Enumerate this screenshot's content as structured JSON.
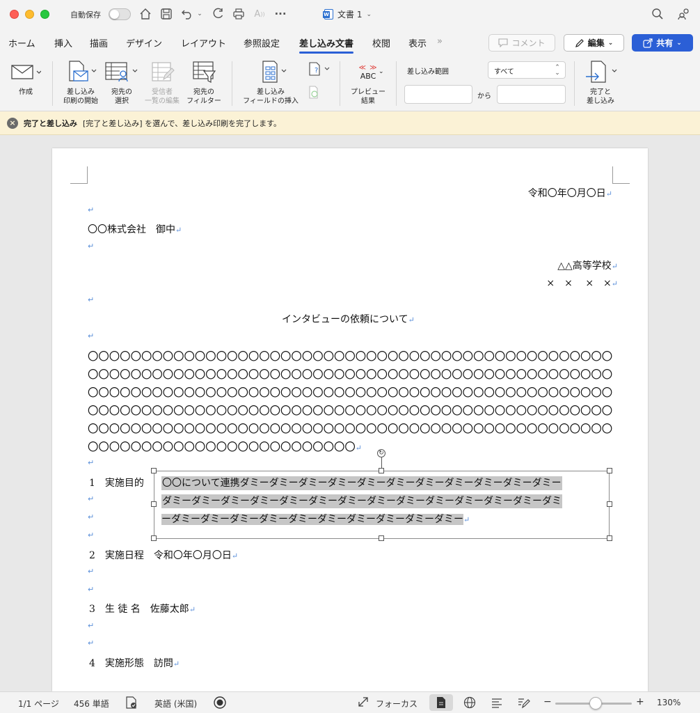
{
  "titlebar": {
    "autosave_label": "自動保存",
    "doc_title": "文書 1",
    "icons": [
      "home-icon",
      "save-icon",
      "undo-icon",
      "redo-icon",
      "print-icon",
      "read-aloud-icon",
      "more-icon",
      "search-icon",
      "share-people-icon"
    ]
  },
  "tabs": [
    {
      "label": "ホーム"
    },
    {
      "label": "挿入"
    },
    {
      "label": "描画"
    },
    {
      "label": "デザイン"
    },
    {
      "label": "レイアウト"
    },
    {
      "label": "参照設定"
    },
    {
      "label": "差し込み文書",
      "active": true
    },
    {
      "label": "校閲"
    },
    {
      "label": "表示"
    }
  ],
  "tab_overflow": "»",
  "buttons": {
    "comment": "コメント",
    "edit": "編集",
    "share": "共有"
  },
  "ribbon": {
    "create": "作成",
    "start_merge": "差し込み\n印刷の開始",
    "select_recipients": "宛先の\n選択",
    "edit_recipients": "受信者\n一覧の編集",
    "filter_recipients": "宛先の\nフィルター",
    "insert_field": "差し込み\nフィールドの挿入",
    "preview_abc": "ABC",
    "preview": "プレビュー\n結果",
    "range_label": "差し込み範囲",
    "range_value": "すべて",
    "range_from_label": "から",
    "finish_merge": "完了と\n差し込み"
  },
  "message_bar": {
    "title": "完了と差し込み",
    "text": "[完了と差し込み] を選んで、差し込み印刷を完了します。"
  },
  "document": {
    "date": "令和〇年〇月〇日",
    "recipient": "〇〇株式会社　御中",
    "sender_school": "△△高等学校",
    "sender_name": "×　×　 ×　×",
    "title": "インタビューの依頼について",
    "circle_lines": [
      "〇〇〇〇〇〇〇〇〇〇〇〇〇〇〇〇〇〇〇〇〇〇〇〇〇〇〇〇〇〇〇〇〇〇〇〇〇〇〇〇〇〇〇〇〇〇〇〇〇",
      "〇〇〇〇〇〇〇〇〇〇〇〇〇〇〇〇〇〇〇〇〇〇〇〇〇〇〇〇〇〇〇〇〇〇〇〇〇〇〇〇〇〇〇〇〇〇〇〇〇",
      "〇〇〇〇〇〇〇〇〇〇〇〇〇〇〇〇〇〇〇〇〇〇〇〇〇〇〇〇〇〇〇〇〇〇〇〇〇〇〇〇〇〇〇〇〇〇〇〇〇",
      "〇〇〇〇〇〇〇〇〇〇〇〇〇〇〇〇〇〇〇〇〇〇〇〇〇〇〇〇〇〇〇〇〇〇〇〇〇〇〇〇〇〇〇〇〇〇〇〇〇",
      "〇〇〇〇〇〇〇〇〇〇〇〇〇〇〇〇〇〇〇〇〇〇〇〇〇〇〇〇〇〇〇〇〇〇〇〇〇〇〇〇〇〇〇〇〇〇〇〇〇",
      "〇〇〇〇〇〇〇〇〇〇〇〇〇〇〇〇〇〇〇〇〇〇〇〇〇"
    ],
    "item1_label": "1　実施目的",
    "textbox_lines": [
      "〇〇について連携ダミーダミーダミーダミーダミーダミーダミーダミーダミーダミーダミー",
      "ダミーダミーダミーダミーダミーダミーダミーダミーダミーダミーダミーダミーダミーダミ",
      "ーダミーダミーダミーダミーダミーダミーダミーダミーダミーダミー"
    ],
    "item2": "2　実施日程　令和〇年〇月〇日",
    "item3": "3　生 徒 名　佐藤太郎",
    "item4": "4　実施形態　訪問",
    "para_mark": "↵"
  },
  "statusbar": {
    "page": "1/1 ページ",
    "words": "456 単語",
    "language": "英語 (米国)",
    "focus": "フォーカス",
    "zoom_minus": "−",
    "zoom_plus": "+",
    "zoom": "130%",
    "zoom_level_percent": 130
  }
}
